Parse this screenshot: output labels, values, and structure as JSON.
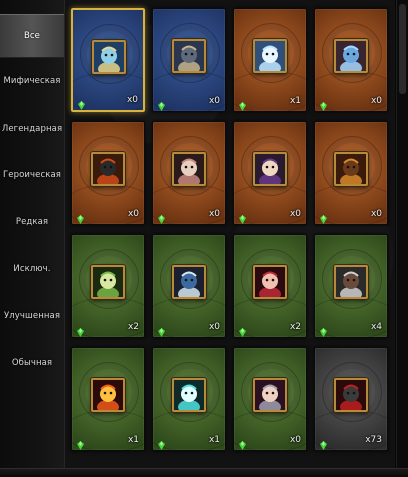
{
  "sidebar": {
    "tabs": [
      {
        "label": "Все",
        "active": true
      },
      {
        "label": "Мифическая",
        "active": false
      },
      {
        "label": "Легендарная",
        "active": false
      },
      {
        "label": "Героическая",
        "active": false
      },
      {
        "label": "Редкая",
        "active": false
      },
      {
        "label": "Исключ.",
        "active": false
      },
      {
        "label": "Улучшенная",
        "active": false
      },
      {
        "label": "Обычная",
        "active": false
      }
    ]
  },
  "rarity_colors": {
    "mythic": "#2d4a86",
    "legendary": "#a9561b",
    "heroic": "#8a4a1a",
    "rare": "#4a6c2b",
    "common": "#4a4a4a",
    "selected_border": "#d8b23c",
    "gem": "#45d63b"
  },
  "cards": [
    {
      "rarity": "mythic",
      "count": "x0",
      "icon": "ice-fairy-icon",
      "selected": true
    },
    {
      "rarity": "mythic",
      "count": "x0",
      "icon": "dark-knight-icon",
      "selected": false
    },
    {
      "rarity": "legendary",
      "count": "x1",
      "icon": "blue-ghost-icon",
      "selected": false
    },
    {
      "rarity": "legendary",
      "count": "x0",
      "icon": "crystal-spirit-icon",
      "selected": false
    },
    {
      "rarity": "legendary",
      "count": "x0",
      "icon": "fire-beast-icon",
      "selected": false
    },
    {
      "rarity": "legendary",
      "count": "x0",
      "icon": "spider-monster-icon",
      "selected": false
    },
    {
      "rarity": "legendary",
      "count": "x0",
      "icon": "witch-icon",
      "selected": false
    },
    {
      "rarity": "legendary",
      "count": "x0",
      "icon": "tiki-mask-icon",
      "selected": false
    },
    {
      "rarity": "rare",
      "count": "x2",
      "icon": "toad-icon",
      "selected": false
    },
    {
      "rarity": "rare",
      "count": "x0",
      "icon": "blue-beast-icon",
      "selected": false
    },
    {
      "rarity": "rare",
      "count": "x2",
      "icon": "red-ninja-icon",
      "selected": false
    },
    {
      "rarity": "rare",
      "count": "x4",
      "icon": "old-sage-icon",
      "selected": false
    },
    {
      "rarity": "rare",
      "count": "x1",
      "icon": "fire-imp-icon",
      "selected": false
    },
    {
      "rarity": "rare",
      "count": "x1",
      "icon": "crystal-ball-icon",
      "selected": false
    },
    {
      "rarity": "rare",
      "count": "x0",
      "icon": "dark-elf-icon",
      "selected": false
    },
    {
      "rarity": "common",
      "count": "x73",
      "icon": "red-goblin-icon",
      "selected": false
    }
  ]
}
